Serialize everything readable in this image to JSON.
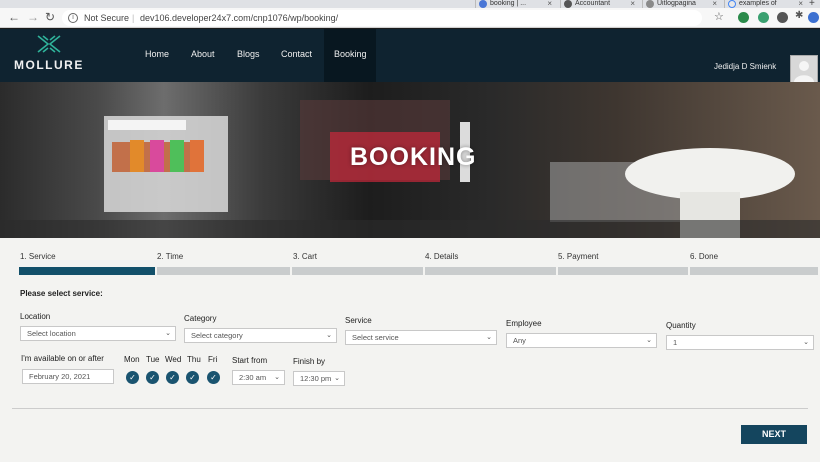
{
  "browser": {
    "tabs": [
      {
        "label": "booking | ..."
      },
      {
        "label": "Accountant"
      },
      {
        "label": "Uitlogpagina"
      },
      {
        "label": "examples of"
      }
    ],
    "security_label": "Not Secure",
    "url": "dev106.developer24x7.com/cnp1076/wp/booking/",
    "icons": [
      "back-icon",
      "forward-icon",
      "reload-icon",
      "info-icon",
      "star-icon",
      "extension-icon"
    ]
  },
  "site": {
    "logo": "MOLLURE",
    "nav": [
      "Home",
      "About",
      "Blogs",
      "Contact",
      "Booking"
    ],
    "active_nav": "Booking",
    "user_name": "Jedidja D Smienk",
    "hero_title": "BOOKING"
  },
  "booking": {
    "steps": [
      "1. Service",
      "2. Time",
      "3. Cart",
      "4. Details",
      "5. Payment",
      "6. Done"
    ],
    "active_step": 1,
    "prompt": "Please select service:",
    "fields": {
      "location": {
        "label": "Location",
        "value": "Select location"
      },
      "category": {
        "label": "Category",
        "value": "Select category"
      },
      "service": {
        "label": "Service",
        "value": "Select service"
      },
      "employee": {
        "label": "Employee",
        "value": "Any"
      },
      "quantity": {
        "label": "Quantity",
        "value": "1"
      }
    },
    "availability": {
      "date_label": "I'm available on or after",
      "date_value": "February 20, 2021",
      "days": [
        "Mon",
        "Tue",
        "Wed",
        "Thu",
        "Fri"
      ],
      "start_label": "Start from",
      "start_value": "2:30 am",
      "finish_label": "Finish by",
      "finish_value": "12:30 pm"
    },
    "next_label": "NEXT"
  },
  "colors": {
    "header": "#0f2330",
    "accent": "#12506a",
    "button": "#14455e"
  }
}
